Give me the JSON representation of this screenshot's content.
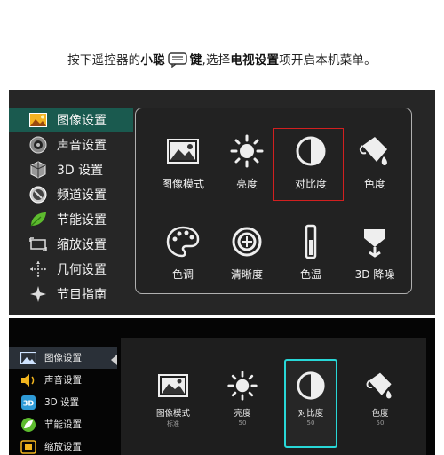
{
  "caption": {
    "part1": "按下遥控器的",
    "bold1": "小聪",
    "bold2": "键",
    "part2": ",选择",
    "bold3": "电视设置",
    "part3": "项开启本机菜单。"
  },
  "screen1": {
    "menu": [
      {
        "label": "图像设置",
        "icon": "picture-icon"
      },
      {
        "label": "声音设置",
        "icon": "speaker-icon"
      },
      {
        "label": "3D 设置",
        "icon": "3d-cube-icon"
      },
      {
        "label": "频道设置",
        "icon": "channel-icon"
      },
      {
        "label": "节能设置",
        "icon": "leaf-icon"
      },
      {
        "label": "缩放设置",
        "icon": "zoom-frame-icon"
      },
      {
        "label": "几何设置",
        "icon": "geometry-icon"
      },
      {
        "label": "节目指南",
        "icon": "guide-star-icon"
      }
    ],
    "active_index": 0,
    "tiles": [
      {
        "label": "图像模式",
        "icon": "picture-mode-icon"
      },
      {
        "label": "亮度",
        "icon": "sun-icon"
      },
      {
        "label": "对比度",
        "icon": "contrast-icon"
      },
      {
        "label": "色度",
        "icon": "paint-bucket-icon"
      },
      {
        "label": "色调",
        "icon": "palette-icon"
      },
      {
        "label": "清晰度",
        "icon": "sharpness-icon"
      },
      {
        "label": "色温",
        "icon": "thermometer-icon"
      },
      {
        "label": "3D 降噪",
        "icon": "noise-reduction-icon"
      }
    ],
    "selected_tile": "对比度",
    "highlight_color": "#d22020",
    "active_color": "#1a5a4f"
  },
  "screen2": {
    "menu": [
      {
        "label": "图像设置",
        "icon": "picture-icon"
      },
      {
        "label": "声音设置",
        "icon": "speaker-icon"
      },
      {
        "label": "3D 设置",
        "icon": "3d-icon"
      },
      {
        "label": "节能设置",
        "icon": "leaf-icon"
      },
      {
        "label": "缩放设置",
        "icon": "zoom-frame-icon"
      }
    ],
    "active_index": 0,
    "tiles": [
      {
        "label": "图像模式",
        "value": "标准",
        "icon": "picture-mode-icon"
      },
      {
        "label": "亮度",
        "value": "50",
        "icon": "sun-icon"
      },
      {
        "label": "对比度",
        "value": "50",
        "icon": "contrast-icon"
      },
      {
        "label": "色度",
        "value": "50",
        "icon": "paint-bucket-icon"
      }
    ],
    "focus_color": "#28d7d7"
  }
}
